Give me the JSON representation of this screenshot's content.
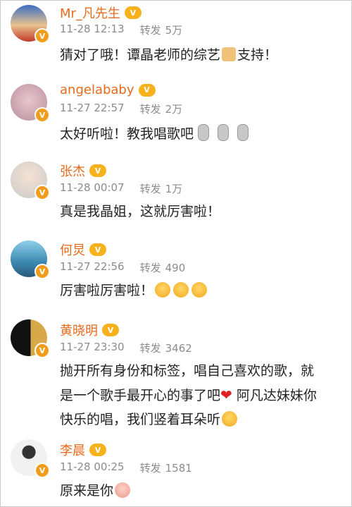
{
  "comments": [
    {
      "name": "Mr_凡先生",
      "time": "11-28 12:13",
      "repost_label": "转发",
      "repost_count": "5万",
      "text": "猜对了哦！谭晶老师的综艺",
      "text2": "支持！",
      "avatar_color": "#4a7bd0"
    },
    {
      "name": "angelababy",
      "time": "11-27 22:57",
      "repost_label": "转发",
      "repost_count": "2万",
      "text": "太好听啦！教我唱歌吧",
      "avatar_color": "#d9a6b8"
    },
    {
      "name": "张杰",
      "time": "11-28 00:07",
      "repost_label": "转发",
      "repost_count": "1万",
      "text": "真是我晶姐，这就厉害啦！",
      "avatar_color": "#dcdcdc"
    },
    {
      "name": "何炅",
      "time": "11-27 22:56",
      "repost_label": "转发",
      "repost_count": "490",
      "text": "厉害啦厉害啦！",
      "avatar_color": "#5fa8c8"
    },
    {
      "name": "黄晓明",
      "time": "11-27 23:30",
      "repost_label": "转发",
      "repost_count": "3462",
      "text_lines": [
        "抛开所有身份和标签，唱自己喜欢的歌，就",
        "是一个歌手最开心的事了吧",
        "阿凡达妹妹你",
        "快乐的唱，我们竖着耳朵听"
      ],
      "avatar_color": "#1a1a1a"
    },
    {
      "name": "李晨",
      "time": "11-28 00:25",
      "repost_label": "转发",
      "repost_count": "1581",
      "text": "原来是你",
      "avatar_color": "#eeeeee"
    }
  ],
  "badges": {
    "verified_symbol": "V",
    "vip_symbol": "V"
  },
  "icons": {
    "verified": "verified-badge-icon",
    "vip": "vip-crown-icon",
    "emoji_face": "smiley-face-icon",
    "emoji_thumb": "thumbs-up-icon",
    "emoji_mic": "microphone-icon",
    "emoji_heart": "heart-icon"
  },
  "colors": {
    "name": "#e86a1b",
    "meta": "#8c8c8c",
    "verified": "#f29d1a"
  }
}
